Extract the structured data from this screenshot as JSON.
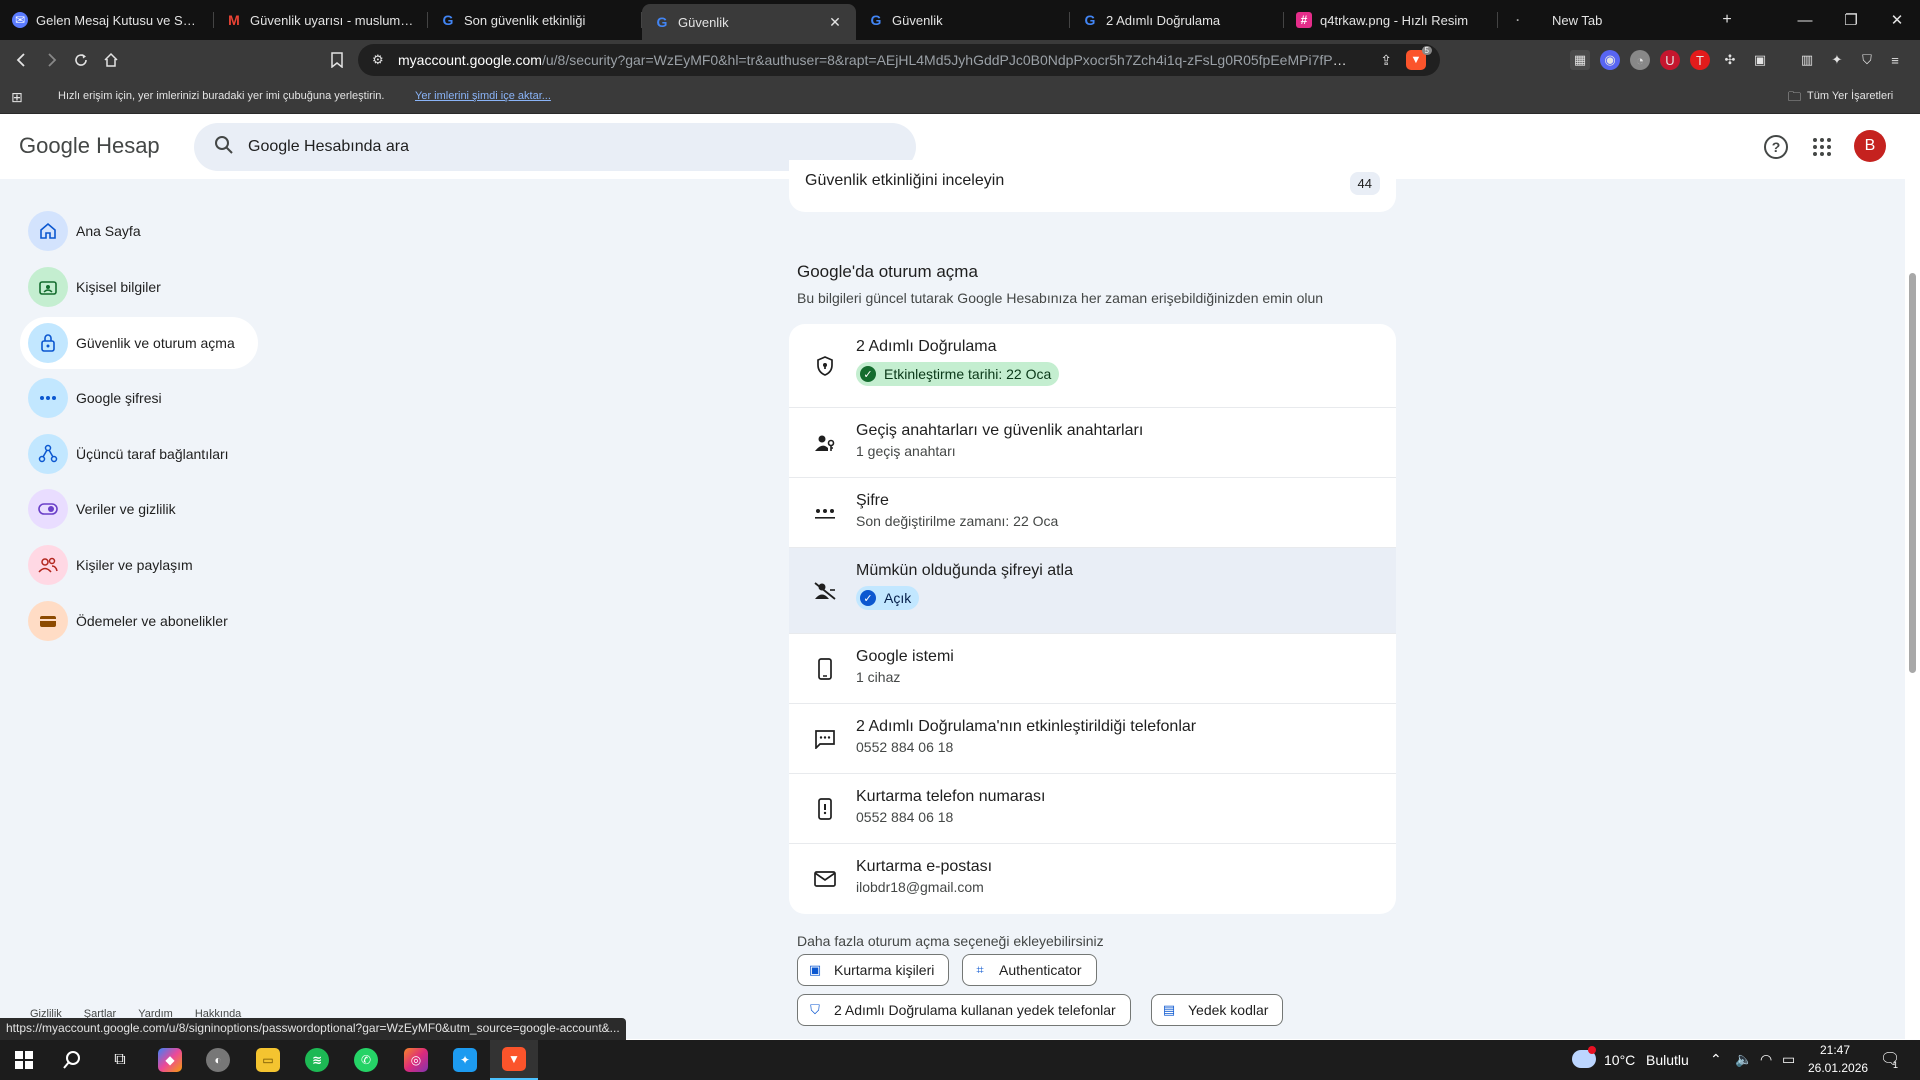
{
  "browser": {
    "tabs": [
      {
        "title": "Gelen Mesaj Kutusu ve Sohbetler",
        "favicon": "messenger-icon",
        "color": "#5b7cff"
      },
      {
        "title": "Güvenlik uyarısı - muslumomer",
        "favicon": "gmail-icon",
        "color": "#ea4335"
      },
      {
        "title": "Son güvenlik etkinliği",
        "favicon": "google-icon",
        "color": "#4285f4"
      },
      {
        "title": "Güvenlik",
        "favicon": "google-icon",
        "color": "#4285f4",
        "active": true
      },
      {
        "title": "Güvenlik",
        "favicon": "google-icon",
        "color": "#4285f4"
      },
      {
        "title": "2 Adımlı Doğrulama",
        "favicon": "google-icon",
        "color": "#4285f4"
      },
      {
        "title": "q4trkaw.png - Hızlı Resim",
        "favicon": "image-host-icon",
        "color": "#e52d8a"
      },
      {
        "title": "New Tab",
        "favicon": "dot",
        "color": "#aaaaaa"
      }
    ],
    "url_host": "myaccount.google.com",
    "url_rest": "/u/8/security?gar=WzEyMF0&hl=tr&authuser=8&rapt=AEjHL4Md5JyhGddPJc0B0NdpPxocr5h7Zch4i1q-zFsLg0R05fpEeMPi7fPNJfq...",
    "brave_badge": "5",
    "bookmarks_hint": "Hızlı erişim için, yer imlerinizi buradaki yer imi çubuğuna yerleştirin.",
    "bookmarks_import": "Yer imlerini şimdi içe aktar...",
    "all_bookmarks": "Tüm Yer İşaretleri",
    "status_url": "https://myaccount.google.com/u/8/signinoptions/passwordoptional?gar=WzEyMF0&utm_source=google-account&..."
  },
  "header": {
    "logo_google": "Google",
    "logo_hesap": "Hesap",
    "search_placeholder": "Google Hesabında ara",
    "avatar_letter": "B"
  },
  "nav": [
    {
      "label": "Ana Sayfa",
      "icon": "home-icon",
      "bg": "#d3e3fd",
      "fg": "#0b57d0"
    },
    {
      "label": "Kişisel bilgiler",
      "icon": "id-card-icon",
      "bg": "#c4eed0",
      "fg": "#146c2e"
    },
    {
      "label": "Güvenlik ve oturum açma",
      "icon": "lock-icon",
      "bg": "#c2e7ff",
      "fg": "#0b57d0",
      "active": true
    },
    {
      "label": "Google şifresi",
      "icon": "password-dots-icon",
      "bg": "#c2e7ff",
      "fg": "#0b57d0"
    },
    {
      "label": "Üçüncü taraf bağlantıları",
      "icon": "connections-icon",
      "bg": "#c2e7ff",
      "fg": "#0b57d0"
    },
    {
      "label": "Veriler ve gizlilik",
      "icon": "toggle-icon",
      "bg": "#e9ddff",
      "fg": "#6a3fc8"
    },
    {
      "label": "Kişiler ve paylaşım",
      "icon": "people-icon",
      "bg": "#ffd8e4",
      "fg": "#b3261e"
    },
    {
      "label": "Ödemeler ve abonelikler",
      "icon": "wallet-icon",
      "bg": "#ffdcc5",
      "fg": "#8c4a00"
    }
  ],
  "footer_links": [
    "Gizlilik",
    "Şartlar",
    "Yardım",
    "Hakkında"
  ],
  "review": {
    "title": "Güvenlik etkinliğini inceleyin",
    "badge": "44"
  },
  "signin_section": {
    "title": "Google'da oturum açma",
    "subtitle": "Bu bilgileri güncel tutarak Google Hesabınıza her zaman erişebildiğinizden emin olun",
    "rows": [
      {
        "title": "2 Adımlı Doğrulama",
        "chip": "Etkinleştirme tarihi: 22 Oca",
        "chip_color": "#c4eed0",
        "dot_color": "#146c2e",
        "icon": "shield-icon"
      },
      {
        "title": "Geçiş anahtarları ve güvenlik anahtarları",
        "sub": "1 geçiş anahtarı",
        "icon": "passkey-icon"
      },
      {
        "title": "Şifre",
        "sub": "Son değiştirilme zamanı: 22 Oca",
        "icon": "password-dots-icon"
      },
      {
        "title": "Mümkün olduğunda şifreyi atla",
        "chip": "Açık",
        "chip_color": "#c2e7ff",
        "dot_color": "#0b57d0",
        "icon": "skip-password-icon",
        "highlight": true
      },
      {
        "title": "Google istemi",
        "sub": "1 cihaz",
        "icon": "phone-icon"
      },
      {
        "title": "2 Adımlı Doğrulama'nın etkinleştirildiği telefonlar",
        "sub": "0552 884 06 18",
        "icon": "sms-icon"
      },
      {
        "title": "Kurtarma telefon numarası",
        "sub": "0552 884 06 18",
        "icon": "phone-alert-icon"
      },
      {
        "title": "Kurtarma e-postası",
        "sub": "ilobdr18@gmail.com",
        "icon": "mail-icon"
      }
    ],
    "more_text": "Daha fazla oturum açma seçeneği ekleyebilirsiniz",
    "buttons": [
      "Kurtarma kişileri",
      "Authenticator",
      "2 Adımlı Doğrulama kullanan yedek telefonlar",
      "Yedek kodlar"
    ]
  },
  "taskbar": {
    "weather_temp": "10°C",
    "weather_text": "Bulutlu",
    "time": "21:47",
    "date": "26.01.2026",
    "notif_count": "1"
  }
}
